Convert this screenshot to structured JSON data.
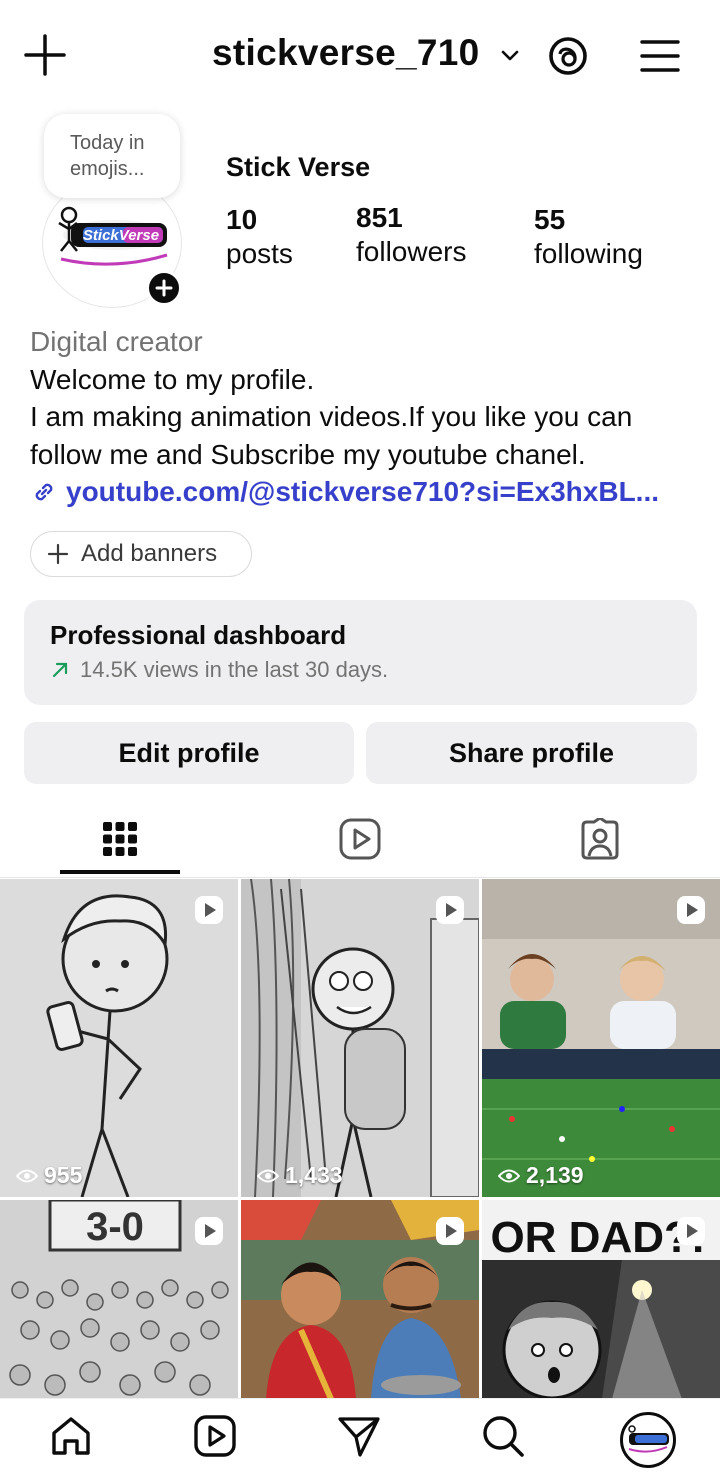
{
  "topbar": {
    "username": "stickverse_710",
    "icons": [
      "plus-icon",
      "chevron-down-icon",
      "threads-icon",
      "hamburger-menu-icon"
    ]
  },
  "profile": {
    "note": "Today in emojis...",
    "avatar_logo_text": "StickVerse",
    "display_name": "Stick Verse",
    "stats": {
      "posts": {
        "value": "10",
        "label": "posts"
      },
      "followers": {
        "value": "851",
        "label": "followers"
      },
      "following": {
        "value": "55",
        "label": "following"
      }
    }
  },
  "bio": {
    "category": "Digital creator",
    "line1": "Welcome to my profile.",
    "line2": "I am making animation videos.If you like you can",
    "line3": "follow me and Subscribe my youtube chanel.",
    "link": "youtube.com/@stickverse710?si=Ex3hxBL..."
  },
  "add_banners": "Add banners",
  "dashboard": {
    "title": "Professional dashboard",
    "subtitle": "14.5K views in the last 30 days.",
    "accent": "#1a9c5b"
  },
  "buttons": {
    "edit": "Edit profile",
    "share": "Share profile"
  },
  "tabs": [
    {
      "name": "grid",
      "icon": "grid-icon",
      "active": true
    },
    {
      "name": "reels",
      "icon": "reels-icon",
      "active": false
    },
    {
      "name": "tagged",
      "icon": "tagged-icon",
      "active": false
    }
  ],
  "posts": [
    {
      "views": "955"
    },
    {
      "views": "1,433"
    },
    {
      "views": "2,139"
    },
    {
      "views": ""
    },
    {
      "views": ""
    },
    {
      "views": ""
    }
  ],
  "post_overlay_text": {
    "scoreboard": "3-0",
    "comic": "OR DAD?!"
  },
  "bottom_nav": [
    "home-icon",
    "reels-icon",
    "messages-icon",
    "search-icon",
    "profile-avatar"
  ],
  "colors": {
    "link": "#3740ca",
    "surface": "#efeff2",
    "text": "#0c0c0c",
    "muted": "#737373"
  }
}
